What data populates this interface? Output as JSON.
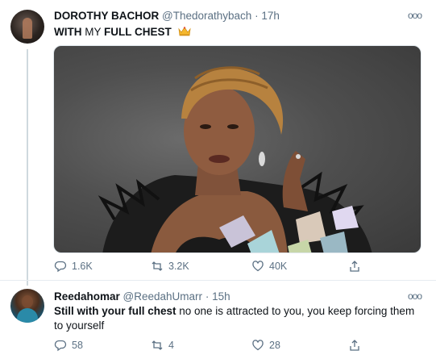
{
  "tweet": {
    "name": "DOROTHY BACHOR",
    "handle": "@Thedorathybach",
    "dot": "·",
    "time": "17h",
    "text_bold1": "WITH",
    "text_mid": "MY",
    "text_bold2": "FULL CHEST",
    "emoji": "crown-emoji",
    "more": "ooo",
    "actions": {
      "replies": "1.6K",
      "retweets": "3.2K",
      "likes": "40K"
    }
  },
  "reply": {
    "name": "Reedahomar",
    "handle": "@ReedahUmarr",
    "dot": "·",
    "time": "15h",
    "text_bold": "Still with your full chest",
    "text_rest": " no one is attracted to you, you keep forcing them to yourself",
    "more": "ooo",
    "actions": {
      "replies": "58",
      "retweets": "4",
      "likes": "28"
    }
  },
  "colors": {
    "muted": "#5b7083",
    "text": "#0f1419",
    "line": "#cfd9de"
  }
}
